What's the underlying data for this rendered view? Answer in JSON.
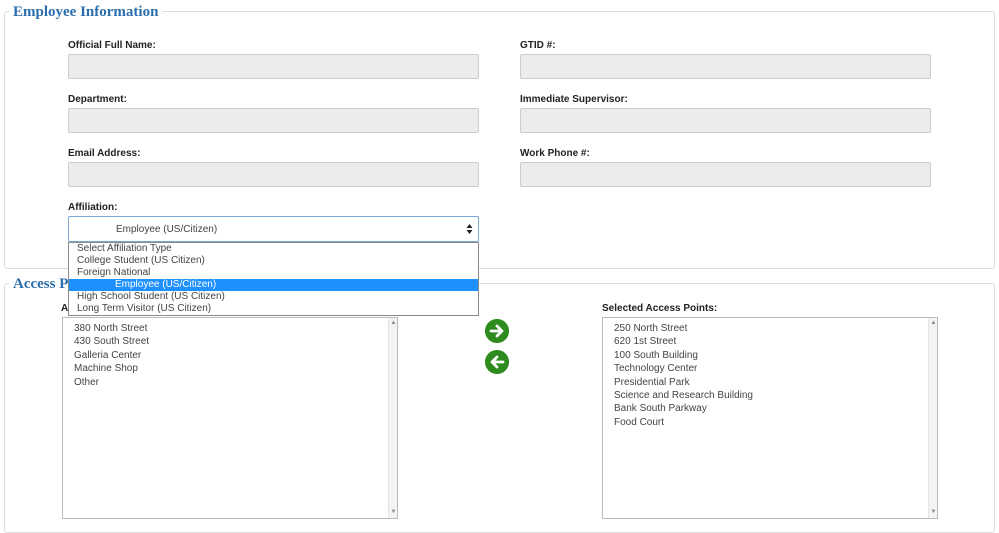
{
  "employee_info": {
    "legend": "Employee Information",
    "fields": {
      "full_name": {
        "label": "Official Full Name:",
        "value": ""
      },
      "gtid": {
        "label": "GTID #:",
        "value": ""
      },
      "department": {
        "label": "Department:",
        "value": ""
      },
      "supervisor": {
        "label": "Immediate Supervisor:",
        "value": ""
      },
      "email": {
        "label": "Email Address:",
        "value": ""
      },
      "work_phone": {
        "label": "Work Phone #:",
        "value": ""
      }
    },
    "affiliation": {
      "label": "Affiliation:",
      "selected": "Employee (US/Citizen)",
      "options": [
        "Select Affiliation Type",
        "College Student (US Citizen)",
        "Foreign National",
        "Employee (US/Citizen)",
        "High School Student (US Citizen)",
        "Long Term Visitor (US Citizen)"
      ],
      "selected_index": 3
    }
  },
  "access_points": {
    "legend": "Access P",
    "available": {
      "label": "A",
      "items": [
        "380 North Street",
        "430 South Street",
        "Galleria Center",
        "Machine Shop",
        "Other"
      ]
    },
    "selected": {
      "label": "Selected Access Points:",
      "items": [
        "250 North Street",
        "620 1st Street",
        "100 South Building",
        "Technology Center",
        "Presidential Park",
        "Science and Research Building",
        "Bank South Parkway",
        "Food Court"
      ]
    },
    "buttons": {
      "add_icon": "arrow-right-circle-icon",
      "remove_icon": "arrow-left-circle-icon"
    },
    "accent_color": "#2e8b1e"
  }
}
